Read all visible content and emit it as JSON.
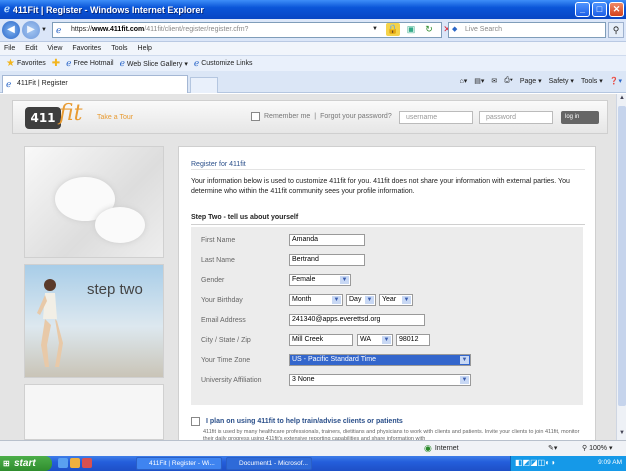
{
  "window": {
    "title": "411Fit | Register - Windows Internet Explorer",
    "controls": {
      "minimize": "_",
      "maximize": "□",
      "close": "✕"
    }
  },
  "addressbar": {
    "scheme": "https://",
    "host": "www.411fit.com",
    "path": "/411fit/client/register/register.cfm?",
    "search_placeholder": "Live Search"
  },
  "menubar": {
    "items": [
      "File",
      "Edit",
      "View",
      "Favorites",
      "Tools",
      "Help"
    ]
  },
  "favorites": {
    "label": "Favorites",
    "items": [
      "Free Hotmail",
      "Web Slice Gallery ▾",
      "Customize Links"
    ]
  },
  "tab": {
    "label": "411Fit | Register"
  },
  "commandbar": {
    "items": [
      "Page ▾",
      "Safety ▾",
      "Tools ▾"
    ]
  },
  "site": {
    "logo_text": "411",
    "logo_script": "fit",
    "tour_link": "Take a Tour",
    "remember_me": "Remember me",
    "forgot_password": "Forgot your password?",
    "username_placeholder": "username",
    "password_placeholder": "password",
    "login_button": "log in"
  },
  "sidebar": {
    "step_label": "step two"
  },
  "register": {
    "heading": "Register for 411fit",
    "intro": "Your information below is used to customize 411fit for you. 411fit does not share your information with external parties. You determine who within the 411fit community sees your profile information.",
    "step_title": "Step Two - tell us about yourself",
    "fields": {
      "first_name": {
        "label": "First Name",
        "value": "Amanda"
      },
      "last_name": {
        "label": "Last Name",
        "value": "Bertrand"
      },
      "gender": {
        "label": "Gender",
        "value": "Female"
      },
      "birthday": {
        "label": "Your Birthday",
        "month": "Month",
        "day": "Day",
        "year": "Year"
      },
      "email": {
        "label": "Email Address",
        "value": "241340@apps.everettsd.org"
      },
      "location": {
        "label": "City / State / Zip",
        "city": "Mill Creek",
        "state": "WA",
        "zip": "98012"
      },
      "timezone": {
        "label": "Your Time Zone",
        "value": "US - Pacific Standard Time"
      },
      "university": {
        "label": "University Affiliation",
        "value": "3 None"
      }
    },
    "plan_label": "I plan on using 411fit to help train/advise clients or patients",
    "plan_text": "411fit is used by many healthcare professionals, trainers, dietitians and physicians to work with clients and patients. Invite your clients to join 411fit, monitor their daily progress using 411fit's extensive reporting capabilities and share information with"
  },
  "statusbar": {
    "zone": "Internet",
    "zoom": "100%"
  },
  "taskbar": {
    "start": "start",
    "tasks": [
      "411Fit | Register - Wi...",
      "Document1 - Microsof..."
    ],
    "time": "9:09 AM"
  }
}
